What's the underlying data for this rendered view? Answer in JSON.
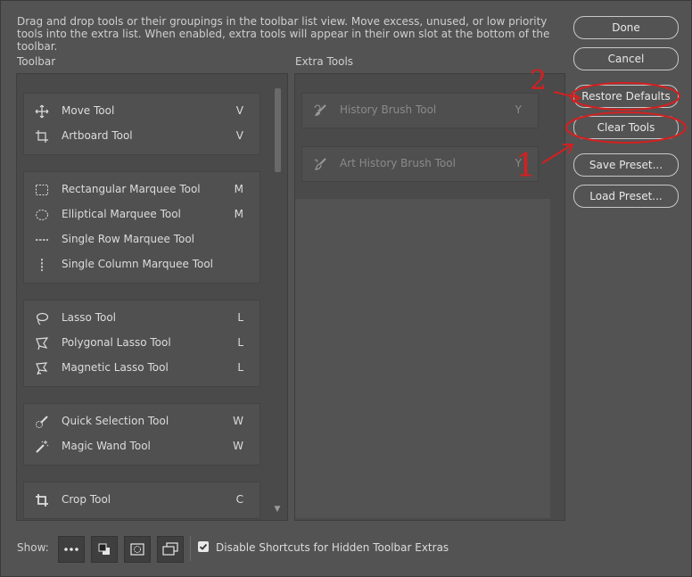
{
  "description": "Drag and drop tools or their groupings in the toolbar list view. Move excess, unused, or low priority tools into the extra list. When enabled, extra tools will appear in their own slot at the bottom of the toolbar.",
  "toolbar_label": "Toolbar",
  "extra_label": "Extra Tools",
  "toolbar_groups": [
    {
      "tools": [
        {
          "name": "Move Tool",
          "key": "V",
          "icon": "move-icon"
        },
        {
          "name": "Artboard Tool",
          "key": "V",
          "icon": "artboard-icon"
        }
      ]
    },
    {
      "tools": [
        {
          "name": "Rectangular Marquee Tool",
          "key": "M",
          "icon": "rect-marquee-icon"
        },
        {
          "name": "Elliptical Marquee Tool",
          "key": "M",
          "icon": "ellipse-marquee-icon"
        },
        {
          "name": "Single Row Marquee Tool",
          "key": "",
          "icon": "row-marquee-icon"
        },
        {
          "name": "Single Column Marquee Tool",
          "key": "",
          "icon": "column-marquee-icon"
        }
      ]
    },
    {
      "tools": [
        {
          "name": "Lasso Tool",
          "key": "L",
          "icon": "lasso-icon"
        },
        {
          "name": "Polygonal Lasso Tool",
          "key": "L",
          "icon": "polygonal-lasso-icon"
        },
        {
          "name": "Magnetic Lasso Tool",
          "key": "L",
          "icon": "magnetic-lasso-icon"
        }
      ]
    },
    {
      "tools": [
        {
          "name": "Quick Selection Tool",
          "key": "W",
          "icon": "quick-selection-icon"
        },
        {
          "name": "Magic Wand Tool",
          "key": "W",
          "icon": "magic-wand-icon"
        }
      ]
    },
    {
      "tools": [
        {
          "name": "Crop Tool",
          "key": "C",
          "icon": "crop-icon"
        }
      ]
    }
  ],
  "extra_groups": [
    {
      "tools": [
        {
          "name": "History Brush Tool",
          "key": "Y",
          "icon": "history-brush-icon"
        }
      ]
    },
    {
      "tools": [
        {
          "name": "Art History Brush Tool",
          "key": "Y",
          "icon": "art-history-brush-icon"
        }
      ]
    }
  ],
  "buttons": {
    "done": "Done",
    "cancel": "Cancel",
    "restore": "Restore Defaults",
    "clear": "Clear Tools",
    "save_preset": "Save Preset...",
    "load_preset": "Load Preset..."
  },
  "show_label": "Show:",
  "show_buttons": [
    "more-icon",
    "fg-bg-colors-icon",
    "quick-mask-icon",
    "screen-mode-icon"
  ],
  "checkbox": {
    "label": "Disable Shortcuts for Hidden Toolbar Extras",
    "checked": true
  },
  "annotations": {
    "one": "1",
    "two": "2",
    "color": "#d42020"
  }
}
